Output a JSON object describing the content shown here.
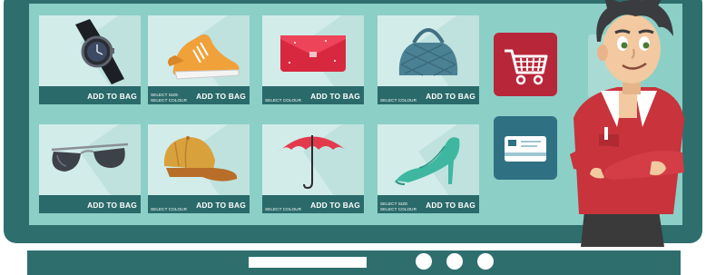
{
  "products": [
    {
      "name": "watch",
      "icon": "watch-icon",
      "options": [],
      "button": "ADD TO BAG"
    },
    {
      "name": "sneaker",
      "icon": "sneaker-icon",
      "options": [
        "SELECT SIZE",
        "SELECT COLOUR"
      ],
      "button": "ADD TO BAG"
    },
    {
      "name": "clutch",
      "icon": "clutch-purse-icon",
      "options": [
        "SELECT COLOUR"
      ],
      "button": "ADD TO BAG"
    },
    {
      "name": "handbag",
      "icon": "handbag-icon",
      "options": [
        "SELECT COLOUR"
      ],
      "button": "ADD TO BAG"
    },
    {
      "name": "sunglasses",
      "icon": "sunglasses-icon",
      "options": [],
      "button": "ADD TO BAG"
    },
    {
      "name": "cap",
      "icon": "cap-icon",
      "options": [
        "SELECT COLOUR"
      ],
      "button": "ADD TO BAG"
    },
    {
      "name": "umbrella",
      "icon": "umbrella-icon",
      "options": [
        "SELECT COLOUR"
      ],
      "button": "ADD TO BAG"
    },
    {
      "name": "high-heel",
      "icon": "high-heel-icon",
      "options": [
        "SELECT SIZE",
        "SELECT COLOUR"
      ],
      "button": "ADD TO BAG"
    }
  ],
  "side_buttons": [
    {
      "name": "cart",
      "icon": "shopping-cart-icon",
      "color": "#b8263a"
    },
    {
      "name": "payment",
      "icon": "credit-card-icon",
      "color": "#2f7183"
    }
  ],
  "colors": {
    "frame": "#2e6f6e",
    "screen": "#8ccfc7",
    "card": "#d2ecea",
    "card_bar": "#2b6a6a"
  },
  "character": {
    "icon": "shop-assistant-illustration"
  }
}
